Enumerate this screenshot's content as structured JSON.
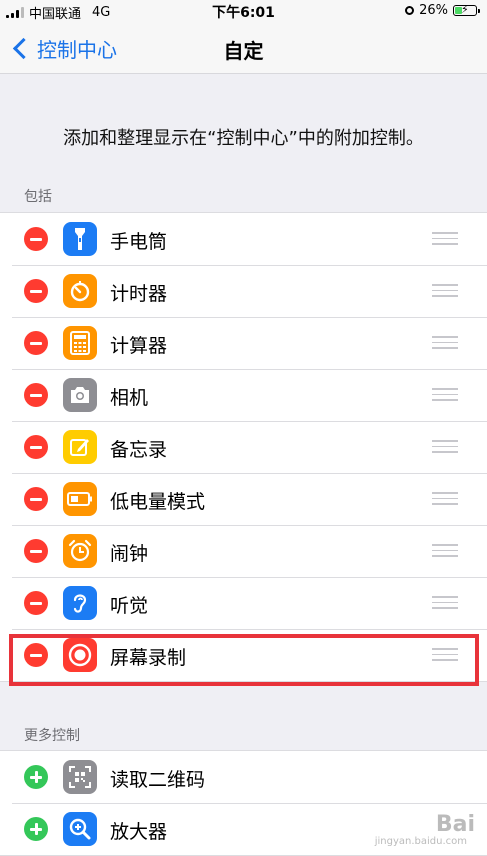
{
  "status_bar": {
    "carrier": "中国联通",
    "network": "4G",
    "time": "下午6:01",
    "battery": "26%"
  },
  "nav": {
    "back_label": "控制中心",
    "title": "自定"
  },
  "description": "添加和整理显示在“控制中心”中的附加控制。",
  "included": {
    "header": "包括",
    "items": [
      {
        "label": "手电筒",
        "icon": "flashlight-icon",
        "color": "#1c7cf4"
      },
      {
        "label": "计时器",
        "icon": "timer-icon",
        "color": "#ff9500"
      },
      {
        "label": "计算器",
        "icon": "calculator-icon",
        "color": "#ff9500"
      },
      {
        "label": "相机",
        "icon": "camera-icon",
        "color": "#8e8e93"
      },
      {
        "label": "备忘录",
        "icon": "notes-icon",
        "color": "#ffcc00"
      },
      {
        "label": "低电量模式",
        "icon": "low-power-icon",
        "color": "#ff9500"
      },
      {
        "label": "闹钟",
        "icon": "alarm-icon",
        "color": "#ff9500"
      },
      {
        "label": "听觉",
        "icon": "hearing-icon",
        "color": "#1c7cf4"
      },
      {
        "label": "屏幕录制",
        "icon": "screen-record-icon",
        "color": "#ff3b30",
        "highlighted": true
      }
    ]
  },
  "more": {
    "header": "更多控制",
    "items": [
      {
        "label": "读取二维码",
        "icon": "qr-code-icon",
        "color": "#8e8e93"
      },
      {
        "label": "放大器",
        "icon": "magnifier-icon",
        "color": "#1c7cf4"
      }
    ]
  },
  "watermark": "Bai",
  "watermark_sub": "jingyan.baidu.com",
  "colors": {
    "highlight_border": "#e8333a",
    "accent": "#1a73e8"
  }
}
